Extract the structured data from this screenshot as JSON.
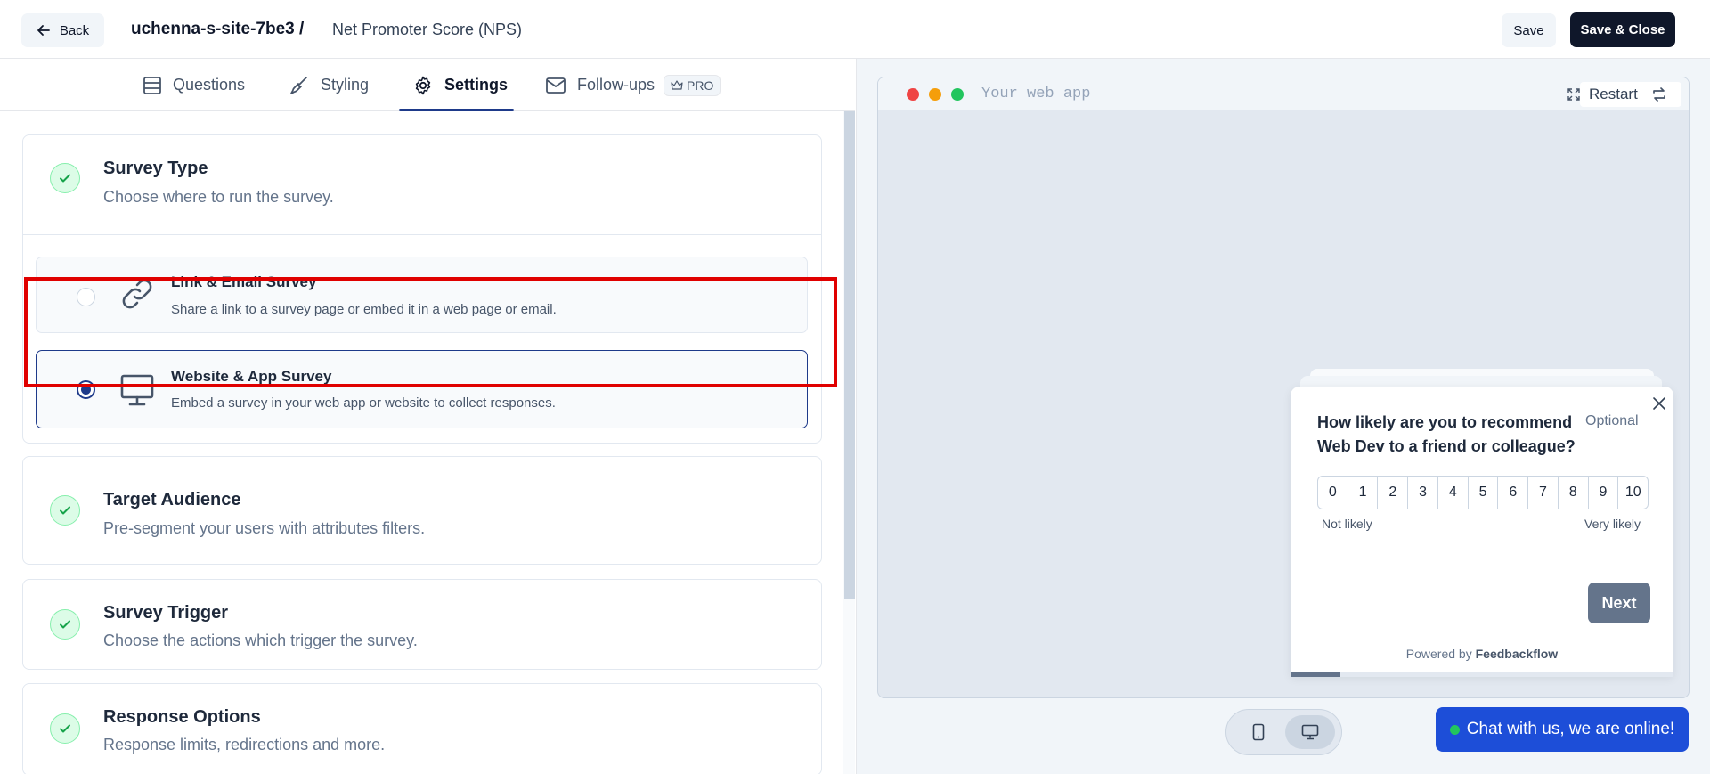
{
  "header": {
    "back_label": "Back",
    "site_name": "uchenna-s-site-7be3 /",
    "survey_name": "Net Promoter Score (NPS)",
    "save_label": "Save",
    "save_close_label": "Save & Close"
  },
  "tabs": [
    {
      "label": "Questions",
      "icon": "questions-icon",
      "active": false
    },
    {
      "label": "Styling",
      "icon": "paintbrush-icon",
      "active": false
    },
    {
      "label": "Settings",
      "icon": "gear-icon",
      "active": true
    },
    {
      "label": "Follow-ups",
      "icon": "mail-icon",
      "active": false,
      "badge": "PRO"
    }
  ],
  "settings": {
    "survey_type": {
      "title": "Survey Type",
      "description": "Choose where to run the survey.",
      "options": [
        {
          "title": "Link & Email Survey",
          "description": "Share a link to a survey page or embed it in a web page or email.",
          "icon": "link-icon",
          "selected": false
        },
        {
          "title": "Website & App Survey",
          "description": "Embed a survey in your web app or website to collect responses.",
          "icon": "monitor-icon",
          "selected": true
        }
      ]
    },
    "target_audience": {
      "title": "Target Audience",
      "description": "Pre-segment your users with attributes filters."
    },
    "survey_trigger": {
      "title": "Survey Trigger",
      "description": "Choose the actions which trigger the survey."
    },
    "response_options": {
      "title": "Response Options",
      "description": "Response limits, redirections and more."
    }
  },
  "preview": {
    "url_text": "Your web app",
    "restart_label": "Restart",
    "question": "How likely are you to recommend Web Dev to a friend or colleague?",
    "optional_label": "Optional",
    "scale": [
      "0",
      "1",
      "2",
      "3",
      "4",
      "5",
      "6",
      "7",
      "8",
      "9",
      "10"
    ],
    "low_label": "Not likely",
    "high_label": "Very likely",
    "next_label": "Next",
    "powered_prefix": "Powered by",
    "powered_brand": "Feedbackflow",
    "progress_fraction": 0.13
  },
  "chat": {
    "label": "Chat with us, we are online!"
  },
  "colors": {
    "accent": "#1e3a8a",
    "highlight": "#e00000",
    "chat": "#1d4ed8",
    "dot_red": "#ef4444",
    "dot_yellow": "#f59e0b",
    "dot_green": "#22c55e"
  }
}
